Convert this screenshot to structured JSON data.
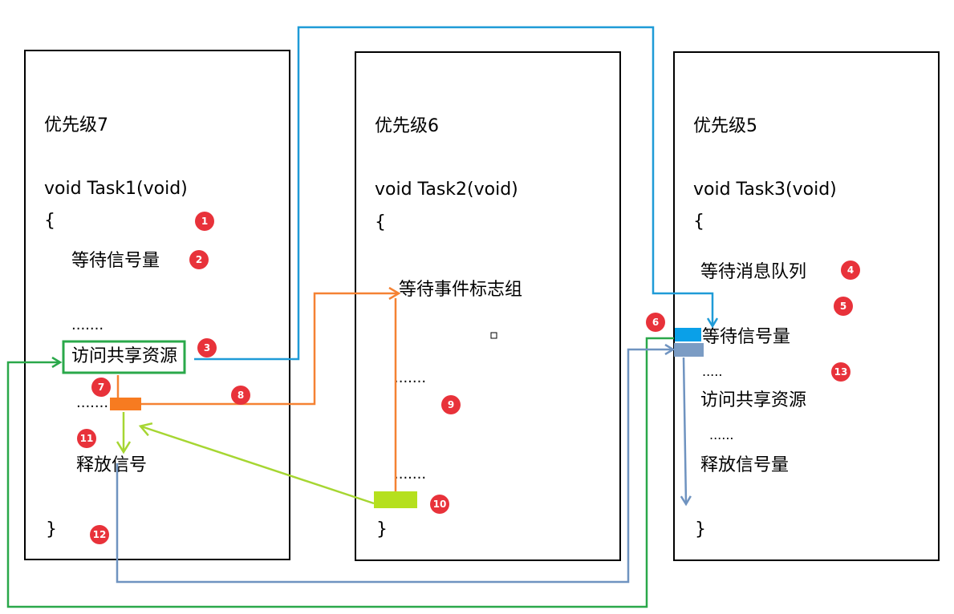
{
  "tasks": [
    {
      "priority": "优先级7",
      "signature": "void Task1(void)",
      "open_brace": "{",
      "close_brace": "}",
      "lines": [
        "等待信号量",
        ".......",
        "访问共享资源",
        ".......",
        "释放信号"
      ]
    },
    {
      "priority": "优先级6",
      "signature": "void Task2(void)",
      "open_brace": "{",
      "close_brace": "}",
      "lines": [
        "等待事件标志组",
        ".......",
        "......."
      ]
    },
    {
      "priority": "优先级5",
      "signature": "void Task3(void)",
      "open_brace": "{",
      "close_brace": "}",
      "lines": [
        "等待消息队列",
        "等待信号量",
        ".....",
        "访问共享资源",
        "......",
        "释放信号量"
      ]
    }
  ],
  "badges": [
    "1",
    "2",
    "3",
    "4",
    "5",
    "6",
    "7",
    "8",
    "9",
    "10",
    "11",
    "12",
    "13"
  ],
  "colors": {
    "blue_arrow": "#1f9bd7",
    "green_arrow": "#2aa84a",
    "orange_arrow": "#f58233",
    "lime_arrow": "#a6d632",
    "steel_arrow": "#6f93c0",
    "badge": "#e8323a",
    "orange_marker": "#f77b20",
    "lime_marker": "#b5e01e",
    "cyan_marker": "#0aa0e8",
    "steel_marker": "#7b9cc4"
  }
}
